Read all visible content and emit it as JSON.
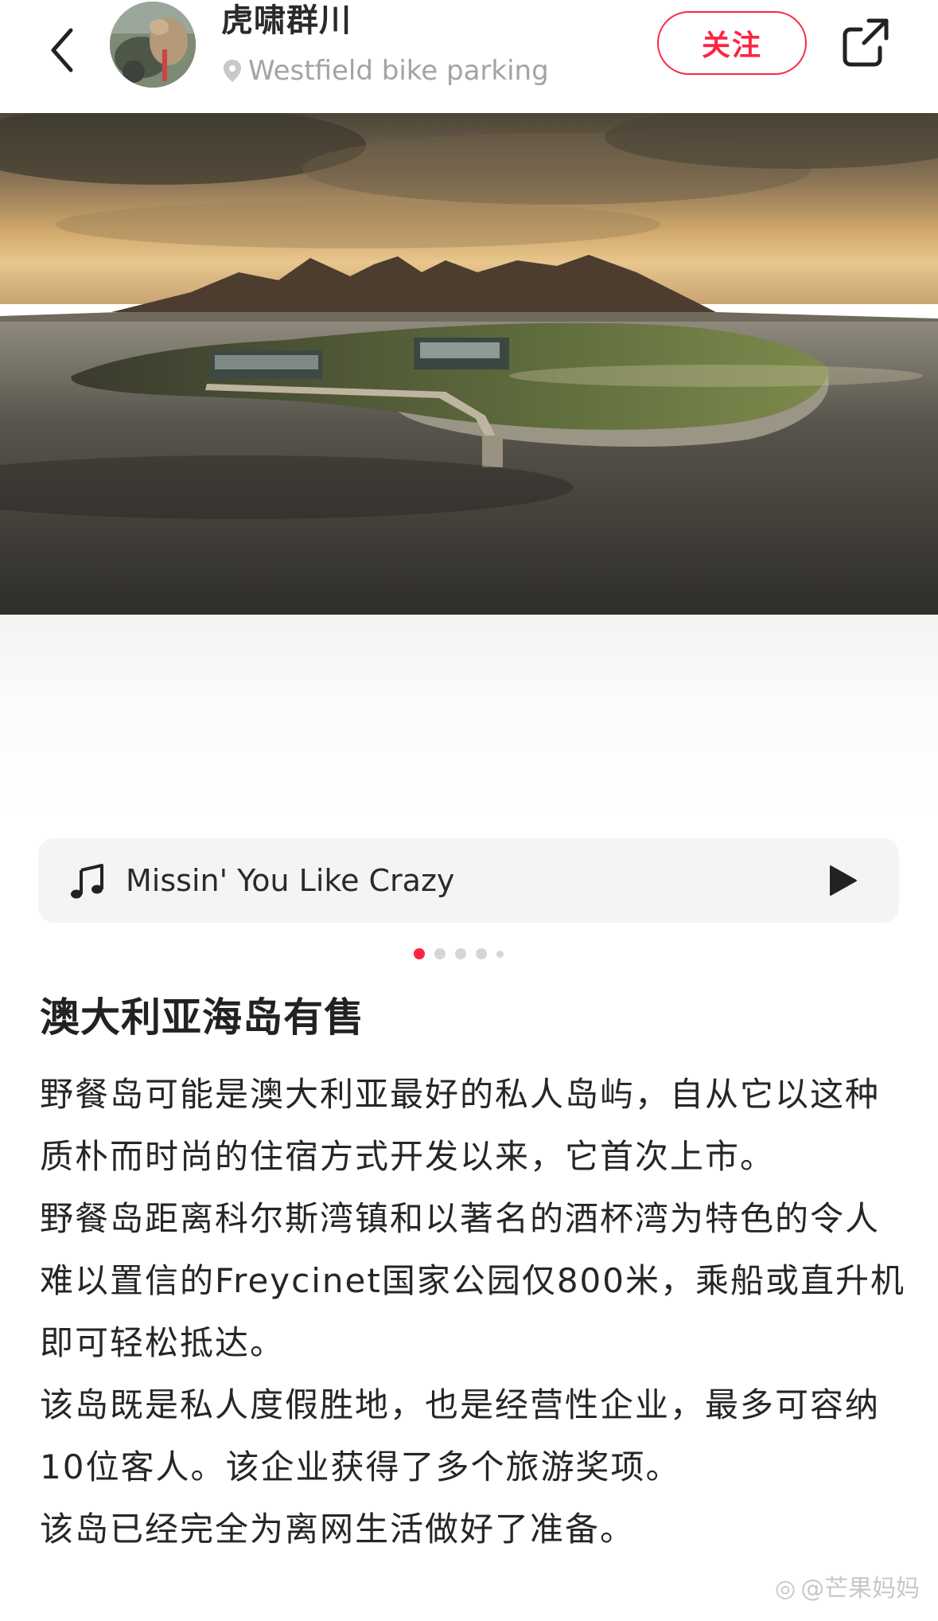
{
  "header": {
    "author": "虎啸群川",
    "location": "Westfield bike parking",
    "follow_label": "关注"
  },
  "icons": {
    "back": "chevron-left-icon",
    "location": "location-pin-icon",
    "share": "share-icon",
    "music": "music-note-icon",
    "play": "play-icon"
  },
  "music": {
    "title": "Missin' You Like Crazy"
  },
  "carousel": {
    "total": 5,
    "active": 1
  },
  "post": {
    "title": "澳大利亚海岛有售",
    "paragraphs": [
      "野餐岛可能是澳大利亚最好的私人岛屿，自从它以这种质朴而时尚的住宿方式开发以来，它首次上市。",
      "野餐岛距离科尔斯湾镇和以著名的酒杯湾为特色的令人难以置信的Freycinet国家公园仅800米，乘船或直升机即可轻松抵达。",
      "该岛既是私人度假胜地，也是经营性企业，最多可容纳10位客人。该企业获得了多个旅游奖项。",
      "该岛已经完全为离网生活做好了准备。"
    ]
  },
  "watermark": "@芒果妈妈",
  "colors": {
    "accent": "#ff2442",
    "muted": "#a3a3a3"
  }
}
